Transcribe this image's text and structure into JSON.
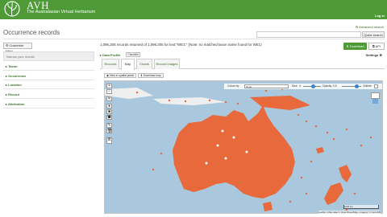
{
  "header": {
    "brand": "AVH",
    "subtitle": "The Australasian Virtual Herbarium",
    "login": "Log in"
  },
  "page": {
    "title": "Occurrence records",
    "advanced_search": "Advanced search",
    "search_placeholder": "",
    "quick_search": "Quick search"
  },
  "sidebar": {
    "customise": "Customise filters",
    "refine": "Narrow your results",
    "facets": [
      "Taxon",
      "Occurrence",
      "Location",
      "Record",
      "Attribution"
    ]
  },
  "results": {
    "summary": "1,096,205 records returned of 1,096,205 for text:\"WE1:\" (Note: no matched taxon name found for WE1)",
    "download": "Download",
    "api": "API",
    "data_profile": "Data Profile",
    "checklist": "Checklist",
    "settings": "Settings"
  },
  "tabs": [
    "Records",
    "Map",
    "Charts",
    "Record images"
  ],
  "map": {
    "view_spatial": "View in spatial portal",
    "download_map": "Download map",
    "colour_by_label": "Colour by:",
    "colour_by_value": "None",
    "size_label": "Size:",
    "size_value": "4",
    "opacity_label": "Opacity:",
    "opacity_value": "0.8",
    "outline_label": "Outline:",
    "scale_text": "1000 km",
    "attribution": "Leaflet | Map data © OpenStreetMap, imagery © CartoDB",
    "colors": {
      "points": "#e8693c",
      "water": "#a9c8de",
      "land": "#efefef"
    }
  }
}
